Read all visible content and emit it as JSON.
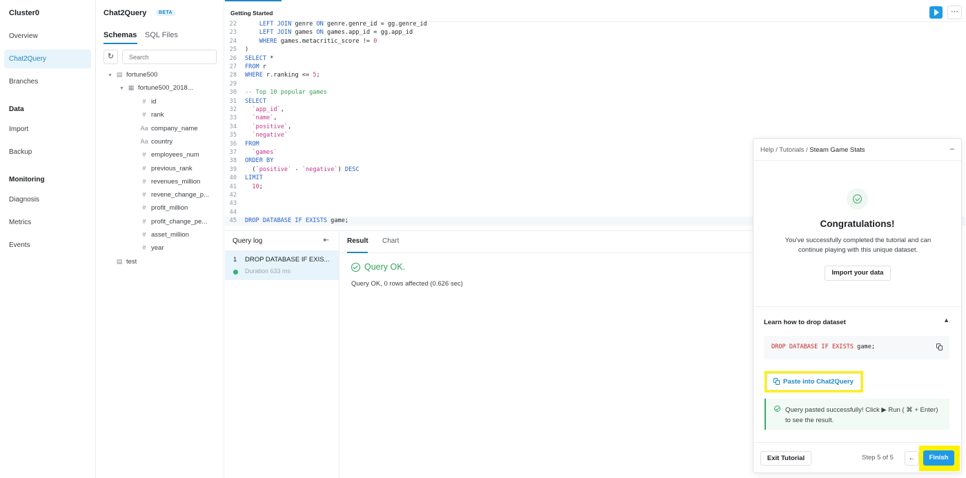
{
  "nav": {
    "cluster": "Cluster0",
    "items": [
      {
        "label": "Overview"
      },
      {
        "label": "Chat2Query"
      },
      {
        "label": "Branches"
      }
    ],
    "data_section": "Data",
    "data_items": [
      {
        "label": "Import"
      },
      {
        "label": "Backup"
      }
    ],
    "monitoring_section": "Monitoring",
    "monitoring_items": [
      {
        "label": "Diagnosis"
      },
      {
        "label": "Metrics"
      },
      {
        "label": "Events"
      }
    ]
  },
  "schema": {
    "title": "Chat2Query",
    "beta": "BETA",
    "tab_schemas": "Schemas",
    "tab_sql_files": "SQL Files",
    "search_placeholder": "Search",
    "db1": "fortune500",
    "table1": "fortune500_2018...",
    "columns": [
      {
        "icon": "#",
        "name": "id"
      },
      {
        "icon": "#",
        "name": "rank"
      },
      {
        "icon": "Aa",
        "name": "company_name"
      },
      {
        "icon": "Aa",
        "name": "country"
      },
      {
        "icon": "#",
        "name": "employees_num"
      },
      {
        "icon": "#",
        "name": "previous_rank"
      },
      {
        "icon": "#",
        "name": "revenues_million"
      },
      {
        "icon": "#",
        "name": "revene_change_p..."
      },
      {
        "icon": "#",
        "name": "profit_million"
      },
      {
        "icon": "#",
        "name": "profit_change_pe..."
      },
      {
        "icon": "#",
        "name": "asset_million"
      },
      {
        "icon": "#",
        "name": "year"
      }
    ],
    "db2": "test"
  },
  "editor": {
    "tab": "Getting Started",
    "more": "⋯",
    "lines": [
      {
        "n": "22",
        "html": "    <span class='kw'>LEFT JOIN</span> genre <span class='kw'>ON</span> genre.genre_id = gg.genre_id"
      },
      {
        "n": "23",
        "html": "    <span class='kw'>LEFT JOIN</span> games <span class='kw'>ON</span> games.app_id = gg.app_id"
      },
      {
        "n": "24",
        "html": "    <span class='kw'>WHERE</span> games.metacritic_score != <span class='num'>0</span>"
      },
      {
        "n": "25",
        "html": ")"
      },
      {
        "n": "26",
        "html": "<span class='kw'>SELECT</span> *"
      },
      {
        "n": "27",
        "html": "<span class='kw'>FROM</span> r"
      },
      {
        "n": "28",
        "html": "<span class='kw'>WHERE</span> r.ranking &lt;= <span class='num'>5</span>;"
      },
      {
        "n": "29",
        "html": ""
      },
      {
        "n": "30",
        "html": "<span class='cm'>-- Top 10 popular games</span>"
      },
      {
        "n": "31",
        "html": "<span class='kw'>SELECT</span>"
      },
      {
        "n": "32",
        "html": "  <span class='str'>`app_id`</span>,"
      },
      {
        "n": "33",
        "html": "  <span class='str'>`name`</span>,"
      },
      {
        "n": "34",
        "html": "  <span class='str'>`positive`</span>,"
      },
      {
        "n": "35",
        "html": "  <span class='str'>`negative`</span>"
      },
      {
        "n": "36",
        "html": "<span class='kw'>FROM</span>"
      },
      {
        "n": "37",
        "html": "  <span class='str'>`games`</span>"
      },
      {
        "n": "38",
        "html": "<span class='kw'>ORDER BY</span>"
      },
      {
        "n": "39",
        "html": "  (<span class='str'>`positive`</span> - <span class='str'>`negative`</span>) <span class='kw'>DESC</span>"
      },
      {
        "n": "40",
        "html": "<span class='kw'>LIMIT</span>"
      },
      {
        "n": "41",
        "html": "  <span class='num'>10</span>;"
      },
      {
        "n": "42",
        "html": ""
      },
      {
        "n": "43",
        "html": ""
      },
      {
        "n": "44",
        "html": ""
      },
      {
        "n": "45",
        "html": "<span class='kw'>DROP DATABASE IF EXISTS</span> game;"
      }
    ]
  },
  "query_log": {
    "title": "Query log",
    "entry_num": "1",
    "entry_query": "DROP DATABASE IF EXIS...",
    "entry_duration": "Duration 633 ms"
  },
  "result": {
    "tab_result": "Result",
    "tab_chart": "Chart",
    "status": "Query OK.",
    "message": "Query OK, 0 rows affected (0.626 sec)"
  },
  "tutorial": {
    "crumb1": "Help",
    "crumb2": "Tutorials",
    "crumb3": "Steam Game Stats",
    "sep": "/",
    "minimize": "–",
    "title": "Congratulations!",
    "desc": "You've successfully completed the tutorial and can continue playing with this unique dataset.",
    "import_button": "Import your data",
    "learn_title": "Learn how to drop dataset",
    "code_kw": "DROP DATABASE IF EXISTS",
    "code_rest": " game;",
    "paste_button": "Paste into Chat2Query",
    "note": "Query pasted successfully! Click ▶ Run ( ⌘ + Enter) to see the result.",
    "exit_button": "Exit Tutorial",
    "step": "Step 5 of 5",
    "back": "←",
    "finish_button": "Finish"
  },
  "colors": {
    "accent": "#1f9ae6",
    "success": "#2fa35e",
    "highlight": "#fff200"
  }
}
